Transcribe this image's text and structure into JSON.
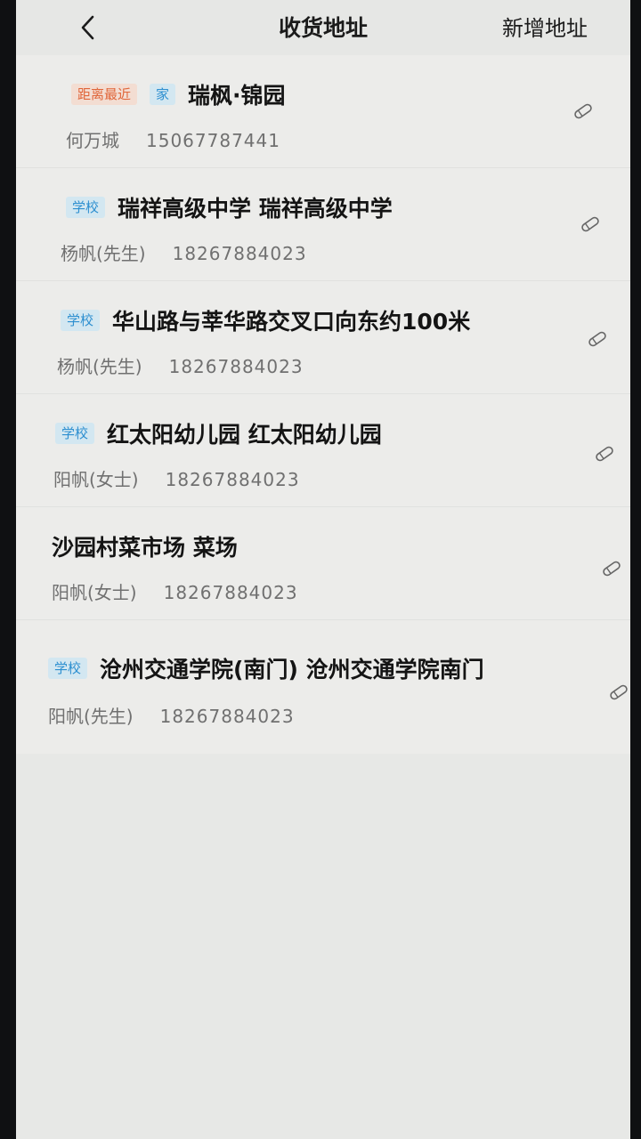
{
  "header": {
    "title": "收货地址",
    "add_label": "新增地址"
  },
  "icons": {
    "back": "chevron-left-icon",
    "edit": "pencil-icon"
  },
  "colors": {
    "tag_near": "#e0663a",
    "tag_type": "#2d8fd0"
  },
  "addresses": [
    {
      "tags": [
        "距离最近",
        "家"
      ],
      "address": "瑞枫·锦园",
      "name": "何万城",
      "phone": "15067787441"
    },
    {
      "tags": [
        "学校"
      ],
      "address": "瑞祥高级中学 瑞祥高级中学",
      "name": "杨帆(先生)",
      "phone": "18267884023"
    },
    {
      "tags": [
        "学校"
      ],
      "address": "华山路与莘华路交叉口向东约100米",
      "name": "杨帆(先生)",
      "phone": "18267884023"
    },
    {
      "tags": [
        "学校"
      ],
      "address": "红太阳幼儿园 红太阳幼儿园",
      "name": "阳帆(女士)",
      "phone": "18267884023"
    },
    {
      "tags": [],
      "address": "沙园村菜市场 菜场",
      "name": "阳帆(女士)",
      "phone": "18267884023"
    },
    {
      "tags": [
        "学校"
      ],
      "address": "沧州交通学院(南门) 沧州交通学院南门",
      "name": "阳帆(先生)",
      "phone": "18267884023"
    }
  ]
}
